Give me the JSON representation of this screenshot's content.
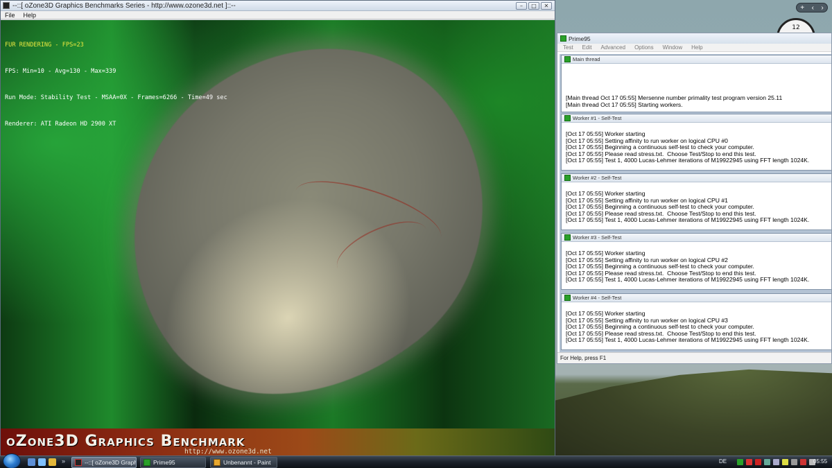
{
  "ozone": {
    "window_title": "--::[ oZone3D Graphics Benchmarks Series - http://www.ozone3d.net ]::--",
    "menu": [
      "File",
      "Help"
    ],
    "hud": {
      "line1": "FUR RENDERING - FPS=23",
      "line2": "FPS: Min=10 - Avg=130 - Max=339",
      "line3": "Run Mode: Stability Test - MSAA=0X - Frames=6266 - Time=49 sec",
      "line4": "Renderer: ATI Radeon HD 2900 XT"
    },
    "banner_title": "oZone3D Graphics Benchmark",
    "banner_url": "http://www.ozone3d.net"
  },
  "prime95": {
    "window_title": "Prime95",
    "menu": [
      "Test",
      "Edit",
      "Advanced",
      "Options",
      "Window",
      "Help"
    ],
    "threads": [
      {
        "title": "Main thread",
        "log": "[Main thread Oct 17 05:55] Mersenne number primality test program version 25.11\n[Main thread Oct 17 05:55] Starting workers."
      },
      {
        "title": "Worker #1 - Self-Test",
        "log": "[Oct 17 05:55] Worker starting\n[Oct 17 05:55] Setting affinity to run worker on logical CPU #0\n[Oct 17 05:55] Beginning a continuous self-test to check your computer.\n[Oct 17 05:55] Please read stress.txt.  Choose Test/Stop to end this test.\n[Oct 17 05:55] Test 1, 4000 Lucas-Lehmer iterations of M19922945 using FFT length 1024K."
      },
      {
        "title": "Worker #2 - Self-Test",
        "log": "[Oct 17 05:55] Worker starting\n[Oct 17 05:55] Setting affinity to run worker on logical CPU #1\n[Oct 17 05:55] Beginning a continuous self-test to check your computer.\n[Oct 17 05:55] Please read stress.txt.  Choose Test/Stop to end this test.\n[Oct 17 05:55] Test 1, 4000 Lucas-Lehmer iterations of M19922945 using FFT length 1024K."
      },
      {
        "title": "Worker #3 - Self-Test",
        "log": "[Oct 17 05:55] Worker starting\n[Oct 17 05:55] Setting affinity to run worker on logical CPU #2\n[Oct 17 05:55] Beginning a continuous self-test to check your computer.\n[Oct 17 05:55] Please read stress.txt.  Choose Test/Stop to end this test.\n[Oct 17 05:55] Test 1, 4000 Lucas-Lehmer iterations of M19922945 using FFT length 1024K."
      },
      {
        "title": "Worker #4 - Self-Test",
        "log": "[Oct 17 05:55] Worker starting\n[Oct 17 05:55] Setting affinity to run worker on logical CPU #3\n[Oct 17 05:55] Beginning a continuous self-test to check your computer.\n[Oct 17 05:55] Please read stress.txt.  Choose Test/Stop to end this test.\n[Oct 17 05:55] Test 1, 4000 Lucas-Lehmer iterations of M19922945 using FFT length 1024K."
      }
    ],
    "status": "For Help, press F1"
  },
  "desktop": {
    "clock_gadget_label": "12"
  },
  "taskbar": {
    "tasks": [
      {
        "label": "--::[ oZone3D Graph...",
        "icon": "ozone3d-app-icon"
      },
      {
        "label": "Prime95",
        "icon": "prime95-app-icon"
      },
      {
        "label": "Unbenannt - Paint",
        "icon": "paint-app-icon"
      }
    ],
    "language": "DE",
    "clock": "05:55"
  },
  "colors": {
    "hud_title": "#e8e840",
    "fur_background_green": "#1f8a2c",
    "prime95_icon_green": "#2aa02a"
  }
}
